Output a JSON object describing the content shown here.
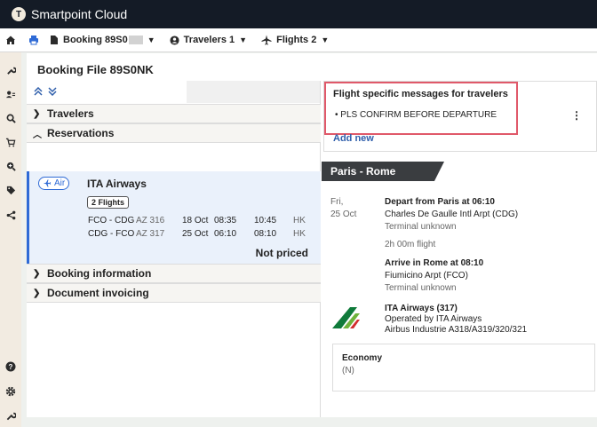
{
  "app": {
    "title": "Smartpoint Cloud",
    "logo_letter": "T"
  },
  "tabs": {
    "booking": {
      "label": "Booking 89S0"
    },
    "travelers": {
      "label": "Travelers 1"
    },
    "flights": {
      "label": "Flights 2"
    }
  },
  "rail_icons": [
    "wrench-icon",
    "user-list-icon",
    "search-icon",
    "cart-icon",
    "search-plus-icon",
    "tag-icon",
    "share-icon",
    "help-icon",
    "gear-icon",
    "tools-icon"
  ],
  "booking": {
    "title": "Booking File 89S0NK"
  },
  "sections": {
    "travelers": "Travelers",
    "reservations": "Reservations",
    "booking_info": "Booking information",
    "doc_invoicing": "Document invoicing"
  },
  "reservation": {
    "badge": "Air",
    "airline": "ITA Airways",
    "flights_pill": "2 Flights",
    "segments": [
      {
        "route": "FCO - CDG",
        "flight": "AZ 316",
        "date": "18 Oct",
        "dep": "08:35",
        "arr": "10:45",
        "status": "HK"
      },
      {
        "route": "CDG - FCO",
        "flight": "AZ 317",
        "date": "25 Oct",
        "dep": "06:10",
        "arr": "08:10",
        "status": "HK"
      }
    ],
    "price_status": "Not priced"
  },
  "messages": {
    "title": "Flight specific messages for travelers",
    "items": [
      "PLS CONFIRM BEFORE DEPARTURE"
    ],
    "add_new": "Add new"
  },
  "route": {
    "banner": "Paris - Rome",
    "day": "Fri,",
    "date": "25 Oct",
    "depart_title": "Depart from Paris at 06:10",
    "depart_airport": "Charles De Gaulle Intl Arpt (CDG)",
    "depart_terminal": "Terminal unknown",
    "duration": "2h 00m flight",
    "arrive_title": "Arrive in Rome at 08:10",
    "arrive_airport": "Fiumicino Arpt (FCO)",
    "arrive_terminal": "Terminal unknown",
    "carrier": "ITA Airways (317)",
    "operated_by": "Operated by ITA Airways",
    "aircraft": "Airbus Industrie A318/A319/320/321",
    "cabin": "Economy",
    "class_code": "(N)"
  },
  "colors": {
    "accent": "#2e6ad6",
    "topbar": "#141b26",
    "highlight": "#e0596a"
  }
}
